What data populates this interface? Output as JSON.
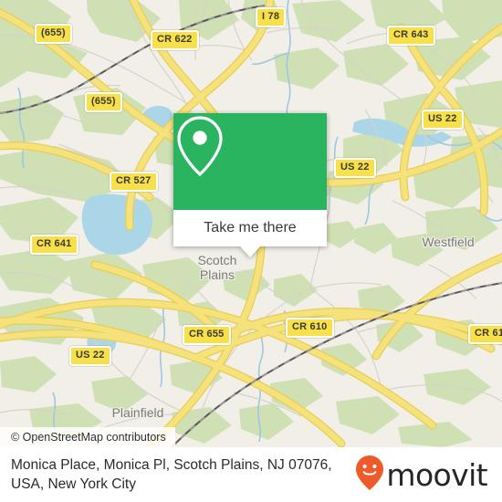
{
  "map": {
    "attribution": "© OpenStreetMap contributors",
    "background_color": "#f2efe9",
    "park_color": "#cfe0b4",
    "water_color": "#abd6e7",
    "road_color": "#f4e06a",
    "shield_color": "#f7e04a",
    "place_labels": [
      {
        "name": "scotch-plains",
        "line1": "Scotch",
        "line2": "Plains"
      },
      {
        "name": "westfield",
        "line1": "Westfield",
        "line2": ""
      },
      {
        "name": "plainfield",
        "line1": "Plainfield",
        "line2": ""
      }
    ],
    "road_shields": [
      {
        "name": "route-shield-655-top",
        "label": "(655)"
      },
      {
        "name": "route-shield-cr-622",
        "label": "CR 622"
      },
      {
        "name": "route-shield-i-78",
        "label": "I 78"
      },
      {
        "name": "route-shield-cr-643",
        "label": "CR 643"
      },
      {
        "name": "route-shield-655-left",
        "label": "(655)"
      },
      {
        "name": "route-shield-us-22-right",
        "label": "US 22"
      },
      {
        "name": "route-shield-cr-527",
        "label": "CR 527"
      },
      {
        "name": "route-shield-us-22-mid",
        "label": "US 22"
      },
      {
        "name": "route-shield-cr-641",
        "label": "CR 641"
      },
      {
        "name": "route-shield-cr-655-bottom",
        "label": "CR 655"
      },
      {
        "name": "route-shield-cr-610",
        "label": "CR 610"
      },
      {
        "name": "route-shield-cr-61",
        "label": "CR 61"
      },
      {
        "name": "route-shield-us-22-bottom-left",
        "label": "US 22"
      }
    ]
  },
  "popup": {
    "action_label": "Take me there",
    "header_color": "#2bb45f",
    "pin_icon": "map-pin-icon"
  },
  "footer": {
    "title": "Monica Place, Monica Pl, Scotch Plains, NJ 07076, USA, New York City",
    "brand_name": "moovit",
    "brand_pin_color": "#ee5a29",
    "brand_text_color": "#262626"
  }
}
